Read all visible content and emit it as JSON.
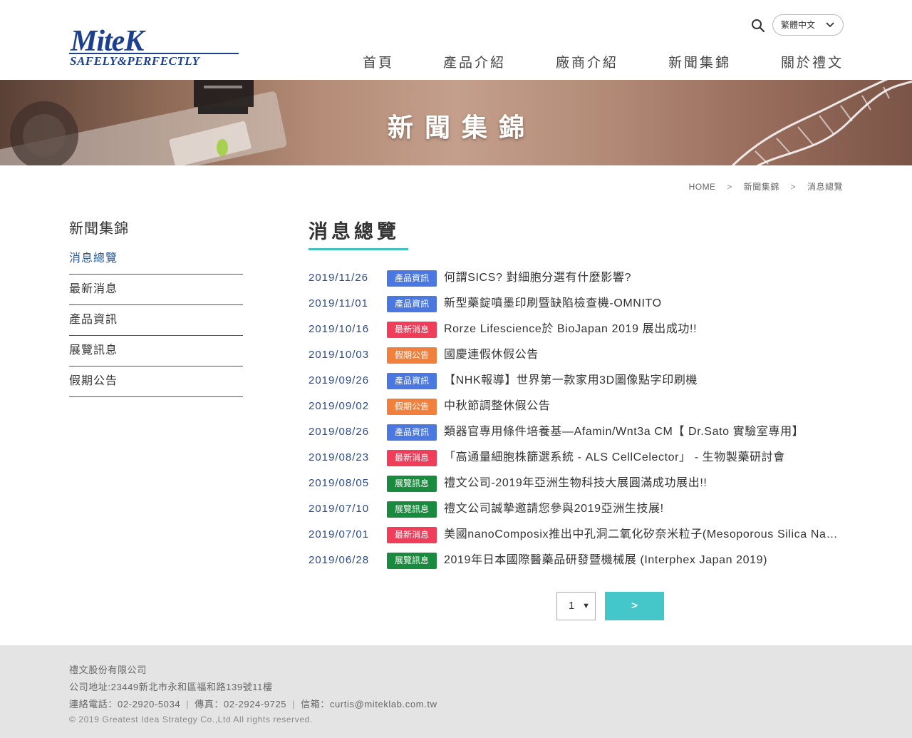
{
  "header": {
    "logo_main": "MiteK",
    "logo_sub": "SAFELY&PERFECTLY",
    "language": "繁體中文",
    "nav": [
      "首頁",
      "產品介紹",
      "廠商介紹",
      "新聞集錦",
      "關於禮文"
    ]
  },
  "banner": {
    "title": "新聞集錦"
  },
  "breadcrumb": {
    "home": "HOME",
    "section": "新聞集錦",
    "current": "消息總覽",
    "separator": ">"
  },
  "sidebar": {
    "title": "新聞集錦",
    "items": [
      "消息總覽",
      "最新消息",
      "產品資訊",
      "展覽訊息",
      "假期公告"
    ],
    "active_index": 0
  },
  "main": {
    "title": "消息總覽",
    "news": [
      {
        "date": "2019/11/26",
        "tag": "產品資訊",
        "title": "何謂SICS? 對細胞分選有什麼影響?"
      },
      {
        "date": "2019/11/01",
        "tag": "產品資訊",
        "title": "新型藥錠噴墨印刷暨缺陷檢查機-OMNITO"
      },
      {
        "date": "2019/10/16",
        "tag": "最新消息",
        "title": "Rorze Lifescience於 BioJapan 2019 展出成功!!"
      },
      {
        "date": "2019/10/03",
        "tag": "假期公告",
        "title": "國慶連假休假公告"
      },
      {
        "date": "2019/09/26",
        "tag": "產品資訊",
        "title": "【NHK報導】世界第一款家用3D圖像點字印刷機"
      },
      {
        "date": "2019/09/02",
        "tag": "假期公告",
        "title": "中秋節調整休假公告"
      },
      {
        "date": "2019/08/26",
        "tag": "產品資訊",
        "title": "類器官專用條件培養基—Afamin/Wnt3a CM【 Dr.Sato 實驗室專用】"
      },
      {
        "date": "2019/08/23",
        "tag": "最新消息",
        "title": "「高通量細胞株篩選系統 - ALS CellCelector」 - 生物製藥研討會"
      },
      {
        "date": "2019/08/05",
        "tag": "展覽訊息",
        "title": "禮文公司-2019年亞洲生物科技大展圓滿成功展出!!"
      },
      {
        "date": "2019/07/10",
        "tag": "展覽訊息",
        "title": "禮文公司誠摯邀請您參與2019亞洲生技展!"
      },
      {
        "date": "2019/07/01",
        "tag": "最新消息",
        "title": "美國nanoComposix推出中孔洞二氧化矽奈米粒子(Mesoporous Silica Nanoparticles)"
      },
      {
        "date": "2019/06/28",
        "tag": "展覽訊息",
        "title": "2019年日本國際醫藥品研發暨機械展 (Interphex Japan 2019)"
      }
    ],
    "tag_colors": {
      "產品資訊": "#4a78e0",
      "最新消息": "#ef3d5a",
      "假期公告": "#f0803c",
      "展覽訊息": "#1a8a3e"
    }
  },
  "pagination": {
    "page": "1",
    "next_label": ">"
  },
  "footer": {
    "company": "禮文股份有限公司",
    "address": "公司地址:23449新北市永和區福和路139號11樓",
    "phone": "連絡電話：02-2920-5034",
    "fax": "傳真：02-2924-9725",
    "email": "信箱：curtis@miteklab.com.tw",
    "separator": "|",
    "copyright": "© 2019 Greatest Idea Strategy Co.,Ltd All rights reserved."
  },
  "colors": {
    "accent": "#44c2c2",
    "link_blue": "#2b4a8a",
    "logo_blue": "#1d3f8f"
  }
}
